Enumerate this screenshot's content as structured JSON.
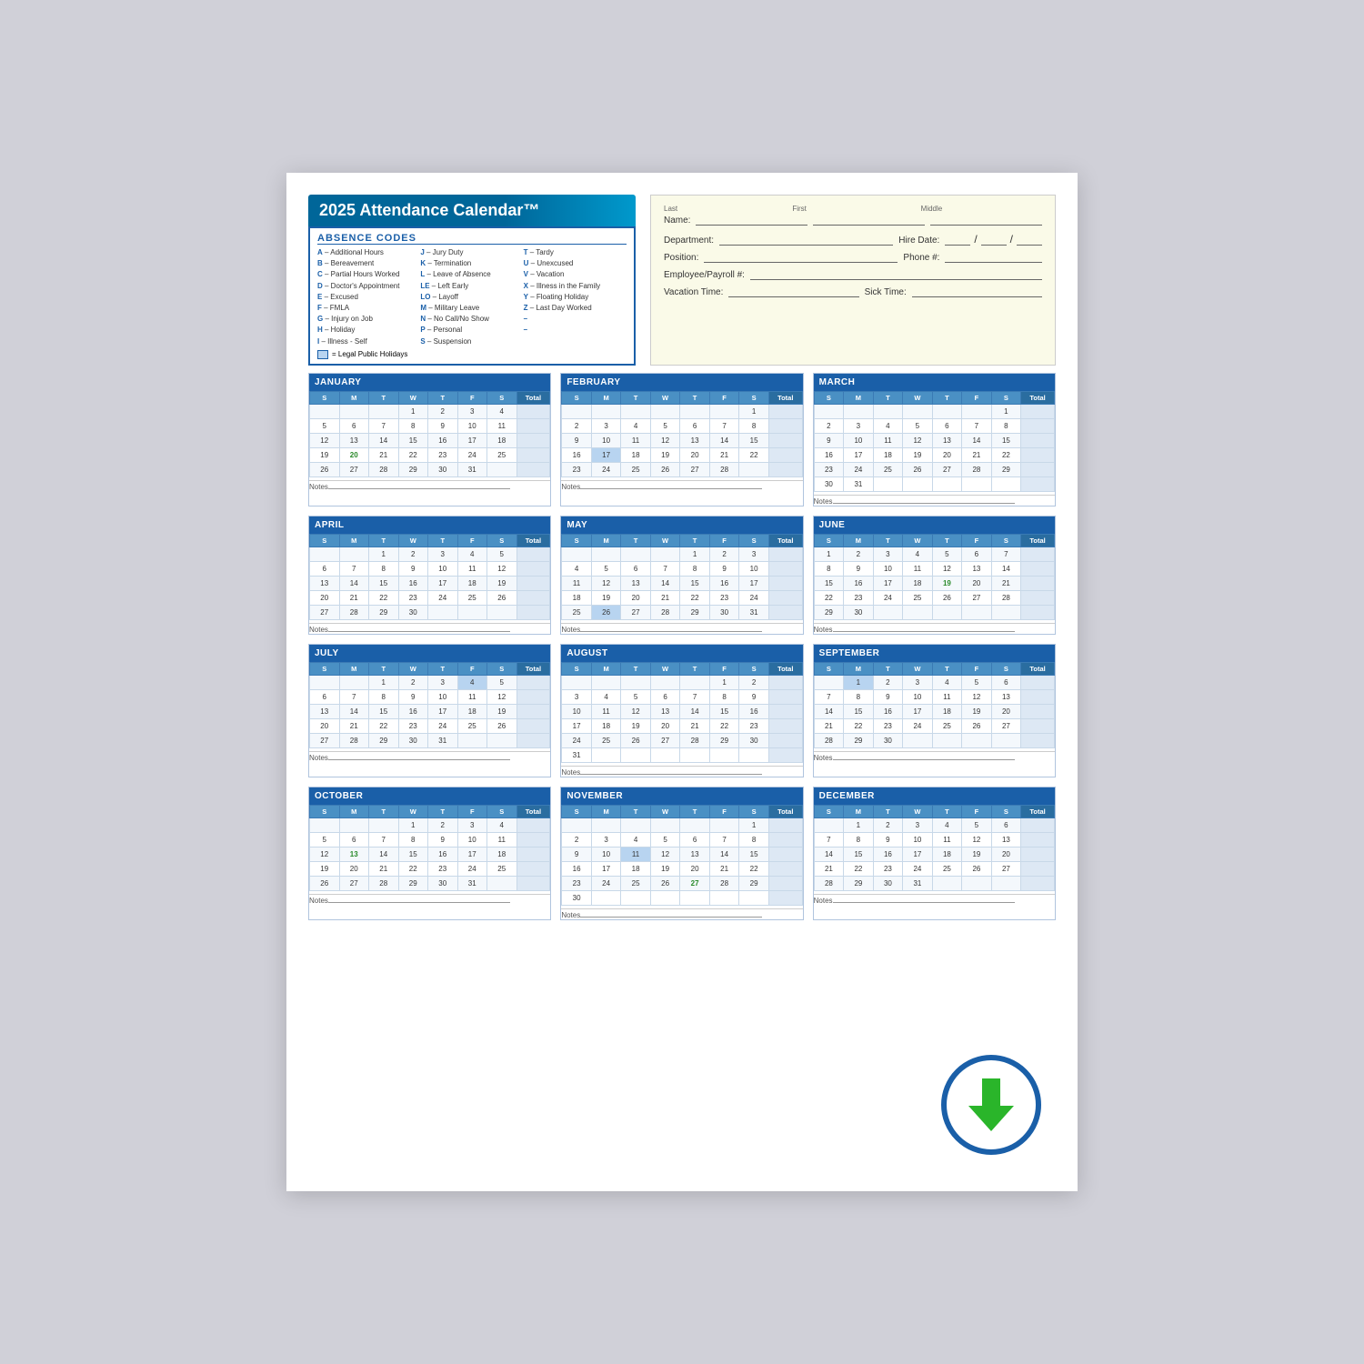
{
  "title": "2025 Attendance Calendar™",
  "absence_codes_title": "ABSENCE CODES",
  "codes_col1": [
    {
      "letter": "A",
      "text": "– Additional Hours"
    },
    {
      "letter": "B",
      "text": "– Bereavement"
    },
    {
      "letter": "C",
      "text": "– Partial Hours Worked"
    },
    {
      "letter": "D",
      "text": "– Doctor's Appointment"
    },
    {
      "letter": "E",
      "text": "– Excused"
    },
    {
      "letter": "F",
      "text": "– FMLA"
    },
    {
      "letter": "G",
      "text": "– Injury on Job"
    },
    {
      "letter": "H",
      "text": "– Holiday"
    },
    {
      "letter": "I",
      "text": "– Illness - Self"
    }
  ],
  "codes_col2": [
    {
      "letter": "J",
      "text": "– Jury Duty"
    },
    {
      "letter": "K",
      "text": "– Termination"
    },
    {
      "letter": "L",
      "text": "– Leave of Absence"
    },
    {
      "letter": "LE",
      "text": "– Left Early"
    },
    {
      "letter": "LO",
      "text": "– Layoff"
    },
    {
      "letter": "M",
      "text": "– Military Leave"
    },
    {
      "letter": "N",
      "text": "– No Call/No Show"
    },
    {
      "letter": "P",
      "text": "– Personal"
    },
    {
      "letter": "S",
      "text": "– Suspension"
    }
  ],
  "codes_col3": [
    {
      "letter": "T",
      "text": "– Tardy"
    },
    {
      "letter": "U",
      "text": "– Unexcused"
    },
    {
      "letter": "V",
      "text": "– Vacation"
    },
    {
      "letter": "X",
      "text": "– Illness in the Family"
    },
    {
      "letter": "Y",
      "text": "– Floating Holiday"
    },
    {
      "letter": "Z",
      "text": "– Last Day Worked"
    },
    {
      "letter": "–",
      "text": ""
    },
    {
      "letter": "–",
      "text": ""
    }
  ],
  "holiday_note": "= Legal Public Holidays",
  "info": {
    "name_label": "Name:",
    "last_label": "Last",
    "first_label": "First",
    "middle_label": "Middle",
    "dept_label": "Department:",
    "hire_label": "Hire Date:",
    "position_label": "Position:",
    "phone_label": "Phone #:",
    "emp_label": "Employee/Payroll #:",
    "vacation_label": "Vacation Time:",
    "sick_label": "Sick Time:"
  },
  "months": [
    {
      "name": "JANUARY",
      "days_header": [
        "S",
        "M",
        "T",
        "W",
        "T",
        "F",
        "S",
        "Total"
      ],
      "weeks": [
        [
          "",
          "",
          "",
          "1",
          "2",
          "3",
          "4",
          ""
        ],
        [
          "5",
          "6",
          "7",
          "8",
          "9",
          "10",
          "11",
          ""
        ],
        [
          "12",
          "13",
          "14",
          "15",
          "16",
          "17",
          "18",
          ""
        ],
        [
          "19",
          "20",
          "21",
          "22",
          "23",
          "24",
          "25",
          ""
        ],
        [
          "26",
          "27",
          "28",
          "29",
          "30",
          "31",
          "",
          ""
        ]
      ],
      "highlights": {
        "3,1": "holiday",
        "3,2": "green-20"
      }
    },
    {
      "name": "FEBRUARY",
      "days_header": [
        "S",
        "M",
        "T",
        "W",
        "T",
        "F",
        "S",
        "Total"
      ],
      "weeks": [
        [
          "",
          "",
          "",
          "",
          "",
          "",
          "1",
          ""
        ],
        [
          "2",
          "3",
          "4",
          "5",
          "6",
          "7",
          "8",
          ""
        ],
        [
          "9",
          "10",
          "11",
          "12",
          "13",
          "14",
          "15",
          ""
        ],
        [
          "16",
          "17",
          "18",
          "19",
          "20",
          "21",
          "22",
          ""
        ],
        [
          "23",
          "24",
          "25",
          "26",
          "27",
          "28",
          "",
          ""
        ]
      ],
      "highlights": {
        "4,2": "holiday-17"
      }
    },
    {
      "name": "MARCH",
      "days_header": [
        "S",
        "M",
        "T",
        "W",
        "T",
        "F",
        "S",
        "Total"
      ],
      "weeks": [
        [
          "",
          "",
          "",
          "",
          "",
          "",
          "1",
          ""
        ],
        [
          "2",
          "3",
          "4",
          "5",
          "6",
          "7",
          "8",
          ""
        ],
        [
          "9",
          "10",
          "11",
          "12",
          "13",
          "14",
          "15",
          ""
        ],
        [
          "16",
          "17",
          "18",
          "19",
          "20",
          "21",
          "22",
          ""
        ],
        [
          "23",
          "24",
          "25",
          "26",
          "27",
          "28",
          "29",
          ""
        ],
        [
          "30",
          "31",
          "",
          "",
          "",
          "",
          "",
          ""
        ]
      ]
    },
    {
      "name": "APRIL",
      "days_header": [
        "S",
        "M",
        "T",
        "W",
        "T",
        "F",
        "S",
        "Total"
      ],
      "weeks": [
        [
          "",
          "",
          "1",
          "2",
          "3",
          "4",
          "5",
          ""
        ],
        [
          "6",
          "7",
          "8",
          "9",
          "10",
          "11",
          "12",
          ""
        ],
        [
          "13",
          "14",
          "15",
          "16",
          "17",
          "18",
          "19",
          ""
        ],
        [
          "20",
          "21",
          "22",
          "23",
          "24",
          "25",
          "26",
          ""
        ],
        [
          "27",
          "28",
          "29",
          "30",
          "",
          "",
          "",
          ""
        ]
      ]
    },
    {
      "name": "MAY",
      "days_header": [
        "S",
        "M",
        "T",
        "W",
        "T",
        "F",
        "S",
        "Total"
      ],
      "weeks": [
        [
          "",
          "",
          "",
          "",
          "1",
          "2",
          "3",
          ""
        ],
        [
          "4",
          "5",
          "6",
          "7",
          "8",
          "9",
          "10",
          ""
        ],
        [
          "11",
          "12",
          "13",
          "14",
          "15",
          "16",
          "17",
          ""
        ],
        [
          "18",
          "19",
          "20",
          "21",
          "22",
          "23",
          "24",
          ""
        ],
        [
          "25",
          "26",
          "27",
          "28",
          "29",
          "30",
          "31",
          ""
        ]
      ],
      "highlights": {
        "5,2": "holiday-26"
      }
    },
    {
      "name": "JUNE",
      "days_header": [
        "S",
        "M",
        "T",
        "W",
        "T",
        "F",
        "S",
        "Total"
      ],
      "weeks": [
        [
          "1",
          "2",
          "3",
          "4",
          "5",
          "6",
          "7",
          ""
        ],
        [
          "8",
          "9",
          "10",
          "11",
          "12",
          "13",
          "14",
          ""
        ],
        [
          "15",
          "16",
          "17",
          "18",
          "19",
          "20",
          "21",
          ""
        ],
        [
          "22",
          "23",
          "24",
          "25",
          "26",
          "27",
          "28",
          ""
        ],
        [
          "29",
          "30",
          "",
          "",
          "",
          "",
          "",
          ""
        ]
      ],
      "highlights": {
        "3,5": "green-19"
      }
    },
    {
      "name": "JULY",
      "days_header": [
        "S",
        "M",
        "T",
        "W",
        "T",
        "F",
        "S",
        "Total"
      ],
      "weeks": [
        [
          "",
          "",
          "1",
          "2",
          "3",
          "4",
          "5",
          ""
        ],
        [
          "6",
          "7",
          "8",
          "9",
          "10",
          "11",
          "12",
          ""
        ],
        [
          "13",
          "14",
          "15",
          "16",
          "17",
          "18",
          "19",
          ""
        ],
        [
          "20",
          "21",
          "22",
          "23",
          "24",
          "25",
          "26",
          ""
        ],
        [
          "27",
          "28",
          "29",
          "30",
          "31",
          "",
          "",
          ""
        ]
      ],
      "highlights": {
        "1,6": "holiday-4"
      }
    },
    {
      "name": "AUGUST",
      "days_header": [
        "S",
        "M",
        "T",
        "W",
        "T",
        "F",
        "S",
        "Total"
      ],
      "weeks": [
        [
          "",
          "",
          "",
          "",
          "",
          "1",
          "2",
          ""
        ],
        [
          "3",
          "4",
          "5",
          "6",
          "7",
          "8",
          "9",
          ""
        ],
        [
          "10",
          "11",
          "12",
          "13",
          "14",
          "15",
          "16",
          ""
        ],
        [
          "17",
          "18",
          "19",
          "20",
          "21",
          "22",
          "23",
          ""
        ],
        [
          "24",
          "25",
          "26",
          "27",
          "28",
          "29",
          "30",
          ""
        ],
        [
          "31",
          "",
          "",
          "",
          "",
          "",
          "",
          ""
        ]
      ]
    },
    {
      "name": "SEPTEMBER",
      "days_header": [
        "S",
        "M",
        "T",
        "W",
        "T",
        "F",
        "S",
        "Total"
      ],
      "weeks": [
        [
          "",
          "1",
          "2",
          "3",
          "4",
          "5",
          "6",
          ""
        ],
        [
          "7",
          "8",
          "9",
          "10",
          "11",
          "12",
          "13",
          ""
        ],
        [
          "14",
          "15",
          "16",
          "17",
          "18",
          "19",
          "20",
          ""
        ],
        [
          "21",
          "22",
          "23",
          "24",
          "25",
          "26",
          "27",
          ""
        ],
        [
          "28",
          "29",
          "30",
          "",
          "",
          "",
          "",
          ""
        ]
      ],
      "highlights": {
        "1,2": "holiday-1"
      }
    },
    {
      "name": "OCTOBER",
      "days_header": [
        "S",
        "M",
        "T",
        "W",
        "T",
        "F",
        "S",
        "Total"
      ],
      "weeks": [
        [
          "",
          "",
          "",
          "1",
          "2",
          "3",
          "4",
          ""
        ],
        [
          "5",
          "6",
          "7",
          "8",
          "9",
          "10",
          "11",
          ""
        ],
        [
          "12",
          "13",
          "14",
          "15",
          "16",
          "17",
          "18",
          ""
        ],
        [
          "19",
          "20",
          "21",
          "22",
          "23",
          "24",
          "25",
          ""
        ],
        [
          "26",
          "27",
          "28",
          "29",
          "30",
          "31",
          "",
          ""
        ]
      ],
      "highlights": {
        "3,2": "green-13"
      }
    },
    {
      "name": "NOVEMBER",
      "days_header": [
        "S",
        "M",
        "T",
        "W",
        "T",
        "F",
        "S",
        "Total"
      ],
      "weeks": [
        [
          "",
          "",
          "",
          "",
          "",
          "",
          "1",
          ""
        ],
        [
          "2",
          "3",
          "4",
          "5",
          "6",
          "7",
          "8",
          ""
        ],
        [
          "9",
          "10",
          "11",
          "12",
          "13",
          "14",
          "15",
          ""
        ],
        [
          "16",
          "17",
          "18",
          "19",
          "20",
          "21",
          "22",
          ""
        ],
        [
          "23",
          "24",
          "25",
          "26",
          "27",
          "28",
          "29",
          ""
        ],
        [
          "30",
          "",
          "",
          "",
          "",
          "",
          "",
          ""
        ]
      ],
      "highlights": {
        "3,3": "holiday-11",
        "5,5": "green-27"
      }
    },
    {
      "name": "DECEMBER",
      "days_header": [
        "S",
        "M",
        "T",
        "W",
        "T",
        "F",
        "S",
        "Total"
      ],
      "weeks": [
        [
          "",
          "1",
          "2",
          "3",
          "4",
          "5",
          "6",
          ""
        ],
        [
          "7",
          "8",
          "9",
          "10",
          "11",
          "12",
          "13",
          ""
        ],
        [
          "14",
          "15",
          "16",
          "17",
          "18",
          "19",
          "20",
          ""
        ],
        [
          "21",
          "22",
          "23",
          "24",
          "25",
          "26",
          "27",
          ""
        ],
        [
          "28",
          "29",
          "30",
          "31",
          "",
          "",
          "",
          ""
        ]
      ]
    }
  ],
  "notes_label": "Notes"
}
